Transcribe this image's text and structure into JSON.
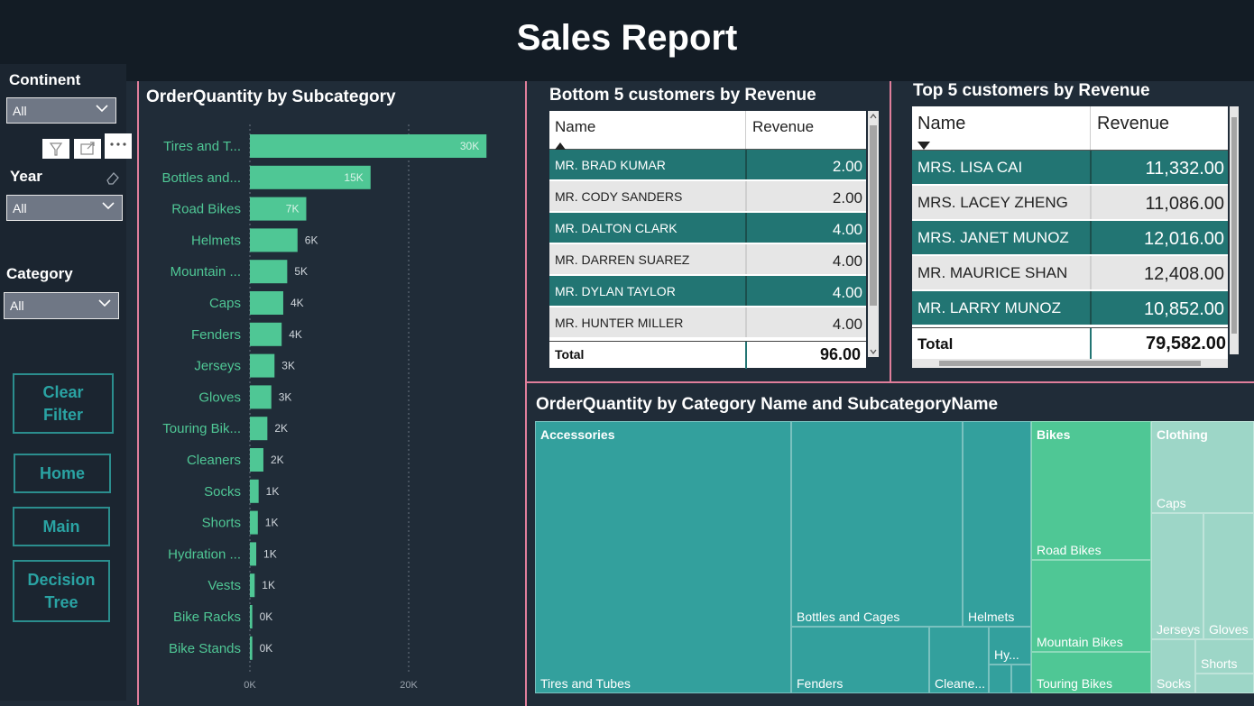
{
  "header": {
    "title": "Sales Report"
  },
  "slicers": {
    "continent": {
      "label": "Continent",
      "value": "All"
    },
    "year": {
      "label": "Year",
      "value": "All"
    },
    "category": {
      "label": "Category",
      "value": "All"
    }
  },
  "nav": {
    "clear_filter": "Clear Filter",
    "home": "Home",
    "main": "Main",
    "decision_tree": "Decision Tree"
  },
  "bar_visual": {
    "title": "OrderQuantity by Subcategory",
    "axis_ticks": [
      "0K",
      "20K"
    ]
  },
  "chart_data": {
    "type": "bar",
    "orientation": "horizontal",
    "title": "OrderQuantity by Subcategory",
    "categories": [
      "Tires and T...",
      "Bottles and...",
      "Road Bikes",
      "Helmets",
      "Mountain ...",
      "Caps",
      "Fenders",
      "Jerseys",
      "Gloves",
      "Touring Bik...",
      "Cleaners",
      "Socks",
      "Shorts",
      "Hydration ...",
      "Vests",
      "Bike Racks",
      "Bike Stands"
    ],
    "values": [
      29800,
      15200,
      7100,
      6000,
      4700,
      4200,
      4000,
      3100,
      2700,
      2200,
      1700,
      1100,
      1000,
      800,
      600,
      300,
      300
    ],
    "labels": [
      "30K",
      "15K",
      "7K",
      "6K",
      "5K",
      "4K",
      "4K",
      "3K",
      "3K",
      "2K",
      "2K",
      "1K",
      "1K",
      "1K",
      "1K",
      "0K",
      "0K"
    ],
    "xlim": [
      0,
      20000
    ],
    "xticks": [
      "0K",
      "20K"
    ],
    "grid": true,
    "color": "#4fc795"
  },
  "bottom5": {
    "title": "Bottom 5 customers by Revenue",
    "col_name": "Name",
    "col_revenue": "Revenue",
    "rows": [
      {
        "name": "MR. BRAD KUMAR",
        "revenue": "2.00"
      },
      {
        "name": "MR. CODY SANDERS",
        "revenue": "2.00"
      },
      {
        "name": "MR. DALTON CLARK",
        "revenue": "4.00"
      },
      {
        "name": "MR. DARREN SUAREZ",
        "revenue": "4.00"
      },
      {
        "name": "MR. DYLAN TAYLOR",
        "revenue": "4.00"
      },
      {
        "name": "MR. HUNTER MILLER",
        "revenue": "4.00"
      }
    ],
    "total_label": "Total",
    "total_value": "96.00"
  },
  "top5": {
    "title": "Top 5 customers by Revenue",
    "col_name": "Name",
    "col_revenue": "Revenue",
    "rows": [
      {
        "name": "MRS. LISA CAI",
        "revenue": "11,332.00"
      },
      {
        "name": "MRS. LACEY ZHENG",
        "revenue": "11,086.00"
      },
      {
        "name": "MRS. JANET MUNOZ",
        "revenue": "12,016.00"
      },
      {
        "name": "MR. MAURICE SHAN",
        "revenue": "12,408.00"
      },
      {
        "name": "MR. LARRY MUNOZ",
        "revenue": "10,852.00"
      }
    ],
    "total_label": "Total",
    "total_value": "79,582.00"
  },
  "treemap": {
    "title": "OrderQuantity by Category Name and SubcategoryName",
    "categories": [
      "Accessories",
      "Bikes",
      "Clothing"
    ],
    "leaves": [
      "Tires and Tubes",
      "Bottles and Cages",
      "Helmets",
      "Fenders",
      "Cleane...",
      "Hy...",
      "Road Bikes",
      "Mountain Bikes",
      "Touring Bikes",
      "Caps",
      "Jerseys",
      "Gloves",
      "Shorts",
      "Socks"
    ],
    "colors": {
      "accessories": "#33a09d",
      "bikes": "#4fc795",
      "clothing": "#9dd6c7"
    }
  }
}
